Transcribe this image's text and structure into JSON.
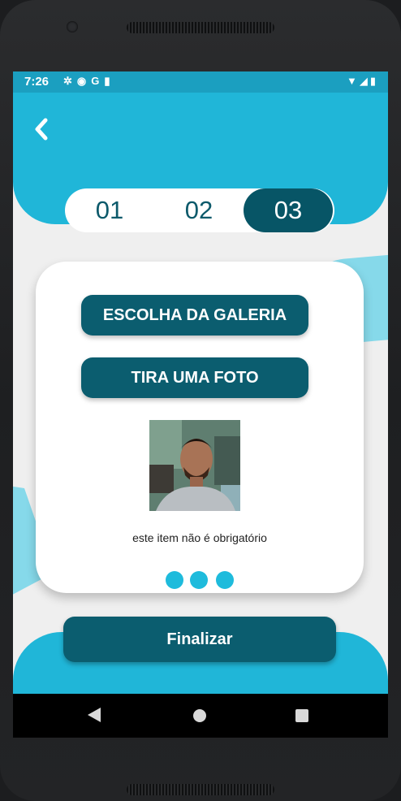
{
  "status_bar": {
    "time": "7:26",
    "left_icons": [
      "settings-icon",
      "shield-icon",
      "google-icon",
      "sd-card-icon"
    ],
    "right_icons": [
      "wifi-icon",
      "signal-icon",
      "battery-icon"
    ]
  },
  "header": {
    "back_icon": "chevron-left-icon",
    "steps": [
      "01",
      "02",
      "03"
    ],
    "active_step": "03"
  },
  "card": {
    "gallery_button": "ESCOLHA DA GALERIA",
    "photo_button": "TIRA UMA FOTO",
    "note": "este item não é obrigatório",
    "dots_count": 3
  },
  "footer": {
    "finish_button": "Finalizar"
  },
  "nav_bar": {
    "icons": [
      "back-triangle-icon",
      "home-circle-icon",
      "recents-square-icon"
    ]
  },
  "colors": {
    "primary": "#20b6d8",
    "dark": "#0b5d6f",
    "light_accent": "#86d9ea",
    "background": "#efefef"
  }
}
